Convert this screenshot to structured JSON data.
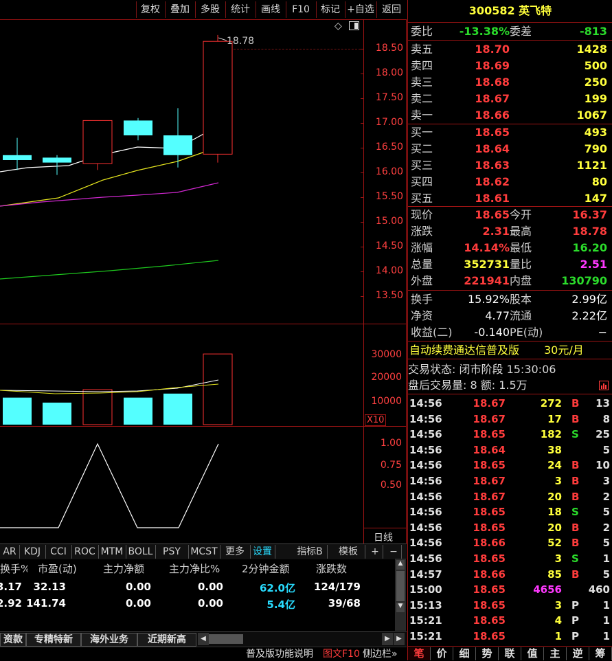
{
  "toolbar": {
    "items": [
      "复权",
      "叠加",
      "多股",
      "统计",
      "画线",
      "F10",
      "标记",
      "+自选",
      "返回"
    ]
  },
  "price_axis": {
    "labels": [
      "18.50",
      "18.00",
      "17.50",
      "17.00",
      "16.50",
      "16.00",
      "15.50",
      "15.00",
      "14.50",
      "14.00",
      "13.50"
    ],
    "color": "#ff4040"
  },
  "high_marker": "18.78",
  "volume_axis": {
    "labels": [
      "30000",
      "20000",
      "10000"
    ],
    "multiplier": "X10"
  },
  "ind_axis": {
    "labels": [
      "1.00",
      "0.75",
      "0.50"
    ]
  },
  "period_label": "日线",
  "chart_data": {
    "type": "candlestick",
    "candles": [
      {
        "open": 16.25,
        "close": 16.35,
        "high": 16.7,
        "low": 16.05,
        "color": "cyan"
      },
      {
        "open": 16.2,
        "close": 16.3,
        "high": 16.35,
        "low": 15.95,
        "color": "cyan"
      },
      {
        "open": 16.18,
        "close": 17.05,
        "high": 17.05,
        "low": 16.05,
        "color": "red"
      },
      {
        "open": 16.75,
        "close": 17.05,
        "high": 17.1,
        "low": 16.65,
        "color": "cyan"
      },
      {
        "open": 16.35,
        "close": 16.75,
        "high": 17.3,
        "low": 16.1,
        "color": "cyan"
      },
      {
        "open": 16.37,
        "close": 18.65,
        "high": 18.78,
        "low": 16.2,
        "color": "red"
      }
    ],
    "volumes": [
      13500,
      11000,
      17500,
      13500,
      15500,
      35300
    ],
    "ylim": [
      13.3,
      18.8
    ]
  },
  "indicator_tabs": [
    "AR",
    "KDJ",
    "CCI",
    "ROC",
    "MTM",
    "BOLL",
    "PSY",
    "MCST",
    "更多",
    "设置",
    "指标B",
    "模板",
    "+",
    "−"
  ],
  "table": {
    "headers": [
      "换手%",
      "市盈(动)",
      "主力净额",
      "主力净比%",
      "2分钟金额",
      "涨跌数"
    ],
    "rows": [
      [
        "3.17",
        "32.13",
        "0.00",
        "0.00",
        "62.0亿",
        "124/179"
      ],
      [
        "2.92",
        "141.74",
        "0.00",
        "0.00",
        "5.4亿",
        "39/68"
      ]
    ]
  },
  "bottom_tabs": [
    "资款",
    "专精特新",
    "海外业务",
    "近期新高"
  ],
  "footer": {
    "items": [
      "普及版功能说明",
      "图文F10",
      "侧边栏»"
    ]
  },
  "stock": {
    "code": "300582",
    "name": "英飞特"
  },
  "weibi": {
    "label": "委比",
    "value": "-13.38%",
    "label2": "委差",
    "value2": "-813"
  },
  "sell": [
    {
      "label": "卖五",
      "price": "18.70",
      "vol": "1428"
    },
    {
      "label": "卖四",
      "price": "18.69",
      "vol": "500"
    },
    {
      "label": "卖三",
      "price": "18.68",
      "vol": "250"
    },
    {
      "label": "卖二",
      "price": "18.67",
      "vol": "199"
    },
    {
      "label": "卖一",
      "price": "18.66",
      "vol": "1067"
    }
  ],
  "buy": [
    {
      "label": "买一",
      "price": "18.65",
      "vol": "493"
    },
    {
      "label": "买二",
      "price": "18.64",
      "vol": "790"
    },
    {
      "label": "买三",
      "price": "18.63",
      "vol": "1121"
    },
    {
      "label": "买四",
      "price": "18.62",
      "vol": "80"
    },
    {
      "label": "买五",
      "price": "18.61",
      "vol": "147"
    }
  ],
  "quote": [
    {
      "l1": "现价",
      "v1": "18.65",
      "c1": "red",
      "l2": "今开",
      "v2": "16.37",
      "c2": "red"
    },
    {
      "l1": "涨跌",
      "v1": "2.31",
      "c1": "red",
      "l2": "最高",
      "v2": "18.78",
      "c2": "red"
    },
    {
      "l1": "涨幅",
      "v1": "14.14%",
      "c1": "red",
      "l2": "最低",
      "v2": "16.20",
      "c2": "grn"
    },
    {
      "l1": "总量",
      "v1": "352731",
      "c1": "yel",
      "l2": "量比",
      "v2": "2.51",
      "c2": "mag"
    },
    {
      "l1": "外盘",
      "v1": "221941",
      "c1": "red",
      "l2": "内盘",
      "v2": "130790",
      "c2": "grn"
    }
  ],
  "fund": [
    {
      "l1": "换手",
      "v1": "15.92%",
      "l2": "股本",
      "v2": "2.99亿"
    },
    {
      "l1": "净资",
      "v1": "4.77",
      "l2": "流通",
      "v2": "2.22亿"
    },
    {
      "l1": "收益(二)",
      "v1": "-0.140",
      "l2": "PE(动)",
      "v2": "−"
    }
  ],
  "promo": {
    "text": "自动续费通达信普及版",
    "price": "30元/月"
  },
  "status": {
    "line1": "交易状态: 闭市阶段 15:30:06",
    "line2": "盘后交易量: 8  额: 1.5万"
  },
  "ticks": [
    {
      "t": "14:56",
      "p": "18.67",
      "v": "272",
      "d": "B",
      "n": "13"
    },
    {
      "t": "14:56",
      "p": "18.67",
      "v": "17",
      "d": "B",
      "n": "8"
    },
    {
      "t": "14:56",
      "p": "18.65",
      "v": "182",
      "d": "S",
      "n": "25"
    },
    {
      "t": "14:56",
      "p": "18.64",
      "v": "38",
      "d": "",
      "n": "5"
    },
    {
      "t": "14:56",
      "p": "18.65",
      "v": "24",
      "d": "B",
      "n": "10"
    },
    {
      "t": "14:56",
      "p": "18.67",
      "v": "3",
      "d": "B",
      "n": "3"
    },
    {
      "t": "14:56",
      "p": "18.67",
      "v": "20",
      "d": "B",
      "n": "2"
    },
    {
      "t": "14:56",
      "p": "18.65",
      "v": "18",
      "d": "S",
      "n": "5"
    },
    {
      "t": "14:56",
      "p": "18.65",
      "v": "20",
      "d": "B",
      "n": "2"
    },
    {
      "t": "14:56",
      "p": "18.66",
      "v": "52",
      "d": "B",
      "n": "5"
    },
    {
      "t": "14:56",
      "p": "18.65",
      "v": "3",
      "d": "S",
      "n": "1"
    },
    {
      "t": "14:57",
      "p": "18.66",
      "v": "85",
      "d": "B",
      "n": "5"
    },
    {
      "t": "15:00",
      "p": "18.65",
      "v": "4656",
      "d": "",
      "n": "460"
    },
    {
      "t": "15:13",
      "p": "18.65",
      "v": "3",
      "d": "P",
      "n": "1"
    },
    {
      "t": "15:21",
      "p": "18.65",
      "v": "4",
      "p2": "P",
      "d": "P",
      "n": "1"
    },
    {
      "t": "15:21",
      "p": "18.65",
      "v": "1",
      "d": "P",
      "n": "1"
    }
  ],
  "right_tabs": [
    "笔",
    "价",
    "细",
    "势",
    "联",
    "值",
    "主",
    "逆",
    "筹"
  ]
}
